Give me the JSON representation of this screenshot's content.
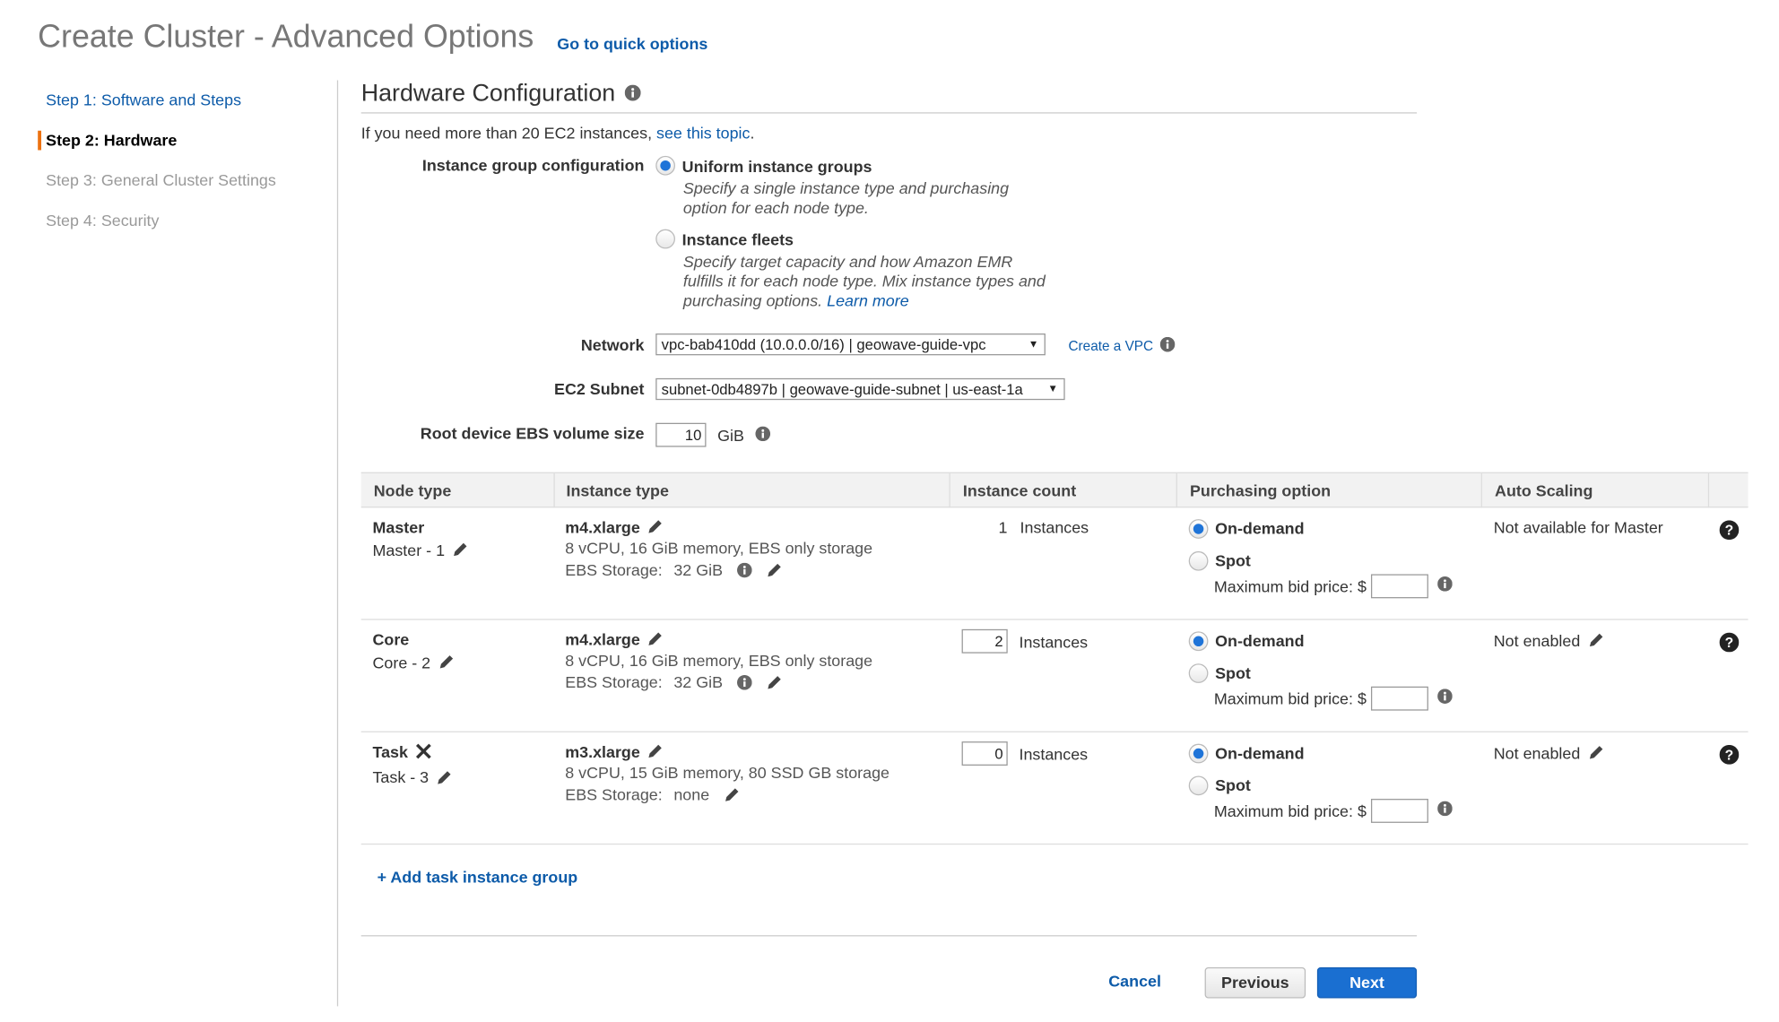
{
  "header": {
    "title": "Create Cluster - Advanced Options",
    "quick_link": "Go to quick options"
  },
  "sidebar": {
    "steps": [
      {
        "label": "Step 1: Software and Steps",
        "state": "link"
      },
      {
        "label": "Step 2: Hardware",
        "state": "active"
      },
      {
        "label": "Step 3: General Cluster Settings",
        "state": "disabled"
      },
      {
        "label": "Step 4: Security",
        "state": "disabled"
      }
    ]
  },
  "section": {
    "title": "Hardware Configuration",
    "intro_text": "If you need more than 20 EC2 instances, ",
    "intro_link": "see this topic",
    "intro_end": "."
  },
  "instance_group": {
    "label": "Instance group configuration",
    "uniform": {
      "title": "Uniform instance groups",
      "desc_line1": "Specify a single instance type and purchasing",
      "desc_line2": "option for each node type.",
      "selected": true
    },
    "fleets": {
      "title": "Instance fleets",
      "desc_line1": "Specify target capacity and how Amazon EMR",
      "desc_line2": "fulfills it for each node type. Mix instance types and",
      "desc_line3": "purchasing options. ",
      "learn_more": "Learn more",
      "selected": false
    }
  },
  "network": {
    "label": "Network",
    "value": "vpc-bab410dd (10.0.0.0/16) | geowave-guide-vpc",
    "create_link": "Create a VPC"
  },
  "subnet": {
    "label": "EC2 Subnet",
    "value": "subnet-0db4897b | geowave-guide-subnet | us-east-1a"
  },
  "root_ebs": {
    "label": "Root device EBS volume size",
    "value": "10",
    "unit": "GiB"
  },
  "table": {
    "headers": [
      "Node type",
      "Instance type",
      "Instance count",
      "Purchasing option",
      "Auto Scaling"
    ],
    "rows": [
      {
        "node_type": "Master",
        "node_name": "Master - 1",
        "instance_type": "m4.xlarge",
        "specs": "8 vCPU, 16 GiB memory, EBS only storage",
        "ebs_label": "EBS Storage:",
        "ebs_value": "32 GiB",
        "count": "1",
        "count_unit": "Instances",
        "on_demand": "On-demand",
        "spot": "Spot",
        "bid_label": "Maximum bid price: $",
        "auto_scaling": "Not available for Master"
      },
      {
        "node_type": "Core",
        "node_name": "Core - 2",
        "instance_type": "m4.xlarge",
        "specs": "8 vCPU, 16 GiB memory, EBS only storage",
        "ebs_label": "EBS Storage:",
        "ebs_value": "32 GiB",
        "count": "2",
        "count_unit": "Instances",
        "on_demand": "On-demand",
        "spot": "Spot",
        "bid_label": "Maximum bid price: $",
        "auto_scaling": "Not enabled"
      },
      {
        "node_type": "Task",
        "node_name": "Task - 3",
        "instance_type": "m3.xlarge",
        "specs": "8 vCPU, 15 GiB memory, 80 SSD GB storage",
        "ebs_label": "EBS Storage:",
        "ebs_value": "none",
        "count": "0",
        "count_unit": "Instances",
        "on_demand": "On-demand",
        "spot": "Spot",
        "bid_label": "Maximum bid price: $",
        "auto_scaling": "Not enabled"
      }
    ]
  },
  "add_task": "+ Add task instance group",
  "buttons": {
    "cancel": "Cancel",
    "previous": "Previous",
    "next": "Next"
  },
  "colors": {
    "link": "#0d5ba9",
    "accent_active_step": "#ec7211",
    "primary_button": "#1a6fd1",
    "radio_selected": "#1f74d8"
  }
}
